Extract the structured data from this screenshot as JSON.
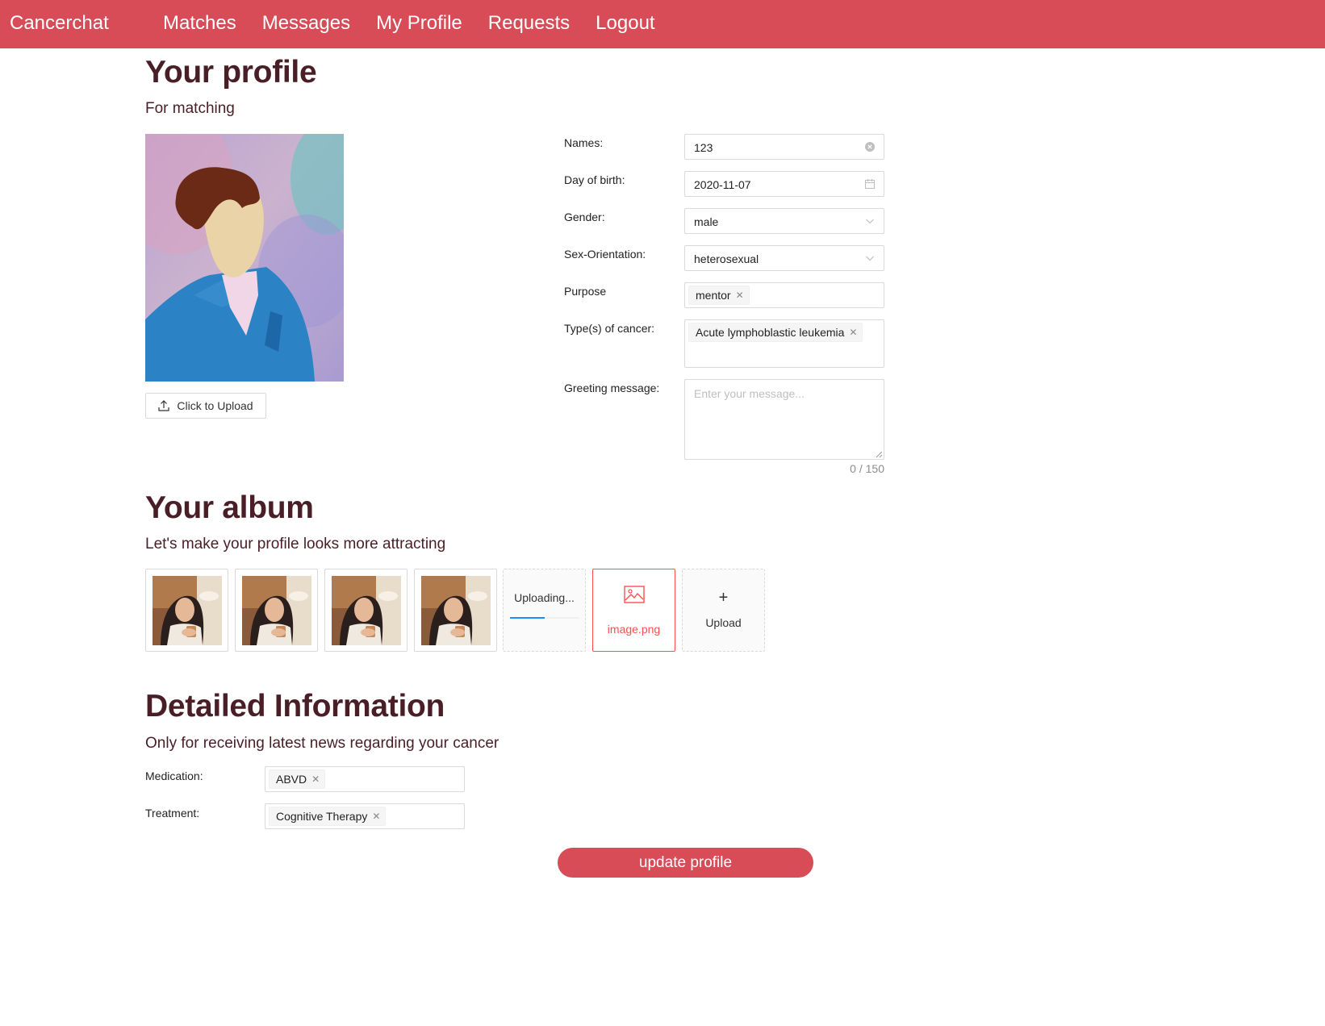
{
  "nav": {
    "brand": "Cancerchat",
    "links": [
      "Matches",
      "Messages",
      "My Profile",
      "Requests",
      "Logout"
    ]
  },
  "profile": {
    "title": "Your profile",
    "subtitle": "For matching",
    "upload_button": "Click to Upload",
    "form": {
      "names_label": "Names:",
      "names_value": "123",
      "dob_label": "Day of birth:",
      "dob_value": "2020-11-07",
      "gender_label": "Gender:",
      "gender_value": "male",
      "orientation_label": "Sex-Orientation:",
      "orientation_value": "heterosexual",
      "purpose_label": "Purpose",
      "purpose_tags": [
        "mentor"
      ],
      "cancer_label": "Type(s) of cancer:",
      "cancer_tags": [
        "Acute lymphoblastic leukemia"
      ],
      "greeting_label": "Greeting message:",
      "greeting_placeholder": "Enter your message...",
      "greeting_counter": "0 / 150"
    }
  },
  "album": {
    "title": "Your album",
    "subtitle": "Let's make your profile looks more attracting",
    "uploading_text": "Uploading...",
    "uploading_progress": 0.5,
    "error_file": "image.png",
    "upload_label": "Upload",
    "icons": [
      "picture-icon",
      "plus-icon"
    ]
  },
  "detailed": {
    "title": "Detailed Information",
    "subtitle": "Only for receiving latest news regarding your cancer",
    "medication_label": "Medication:",
    "medication_tags": [
      "ABVD"
    ],
    "treatment_label": "Treatment:",
    "treatment_tags": [
      "Cognitive Therapy"
    ]
  },
  "submit_label": "update profile",
  "colors": {
    "nav_bg": "#d74c57",
    "heading": "#4a1e26",
    "error": "#ff4d4f",
    "progress": "#1890ff"
  }
}
